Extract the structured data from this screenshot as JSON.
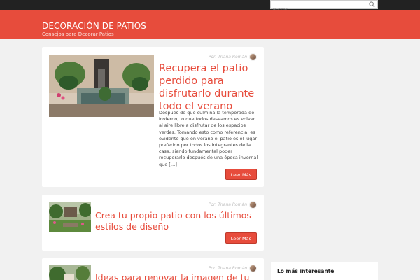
{
  "search": {
    "placeholder": "Buscar",
    "icon": "magnifier-icon"
  },
  "site": {
    "title": "DECORACIÓN DE PATIOS",
    "tagline": "Consejos para Decorar Patios",
    "accent": "#e74c3c"
  },
  "posts": [
    {
      "title": "Recupera el patio perdido para disfrutarlo durante todo el verano",
      "author": "Por: Triana Román",
      "excerpt": "Después de que culmina la temporada de invierno, lo que todos deseamos es volver al aire libre a disfrutar de los espacios verdes. Tomando esto como referencia, es evidente que en verano el patio es el lugar preferido por todos los integrantes de la casa, siendo fundamental poder recuperarlo después de una época invernal que […]",
      "more": "Leer Más"
    },
    {
      "title": "Crea tu propio patio con los últimos estilos de diseño",
      "author": "Por: Triana Román",
      "more": "Leer Más"
    },
    {
      "title": "Ideas para renovar la imagen de tu",
      "author": "Por: Triana Román"
    }
  ],
  "sidebar": {
    "widget_title": "Lo más interesante"
  }
}
